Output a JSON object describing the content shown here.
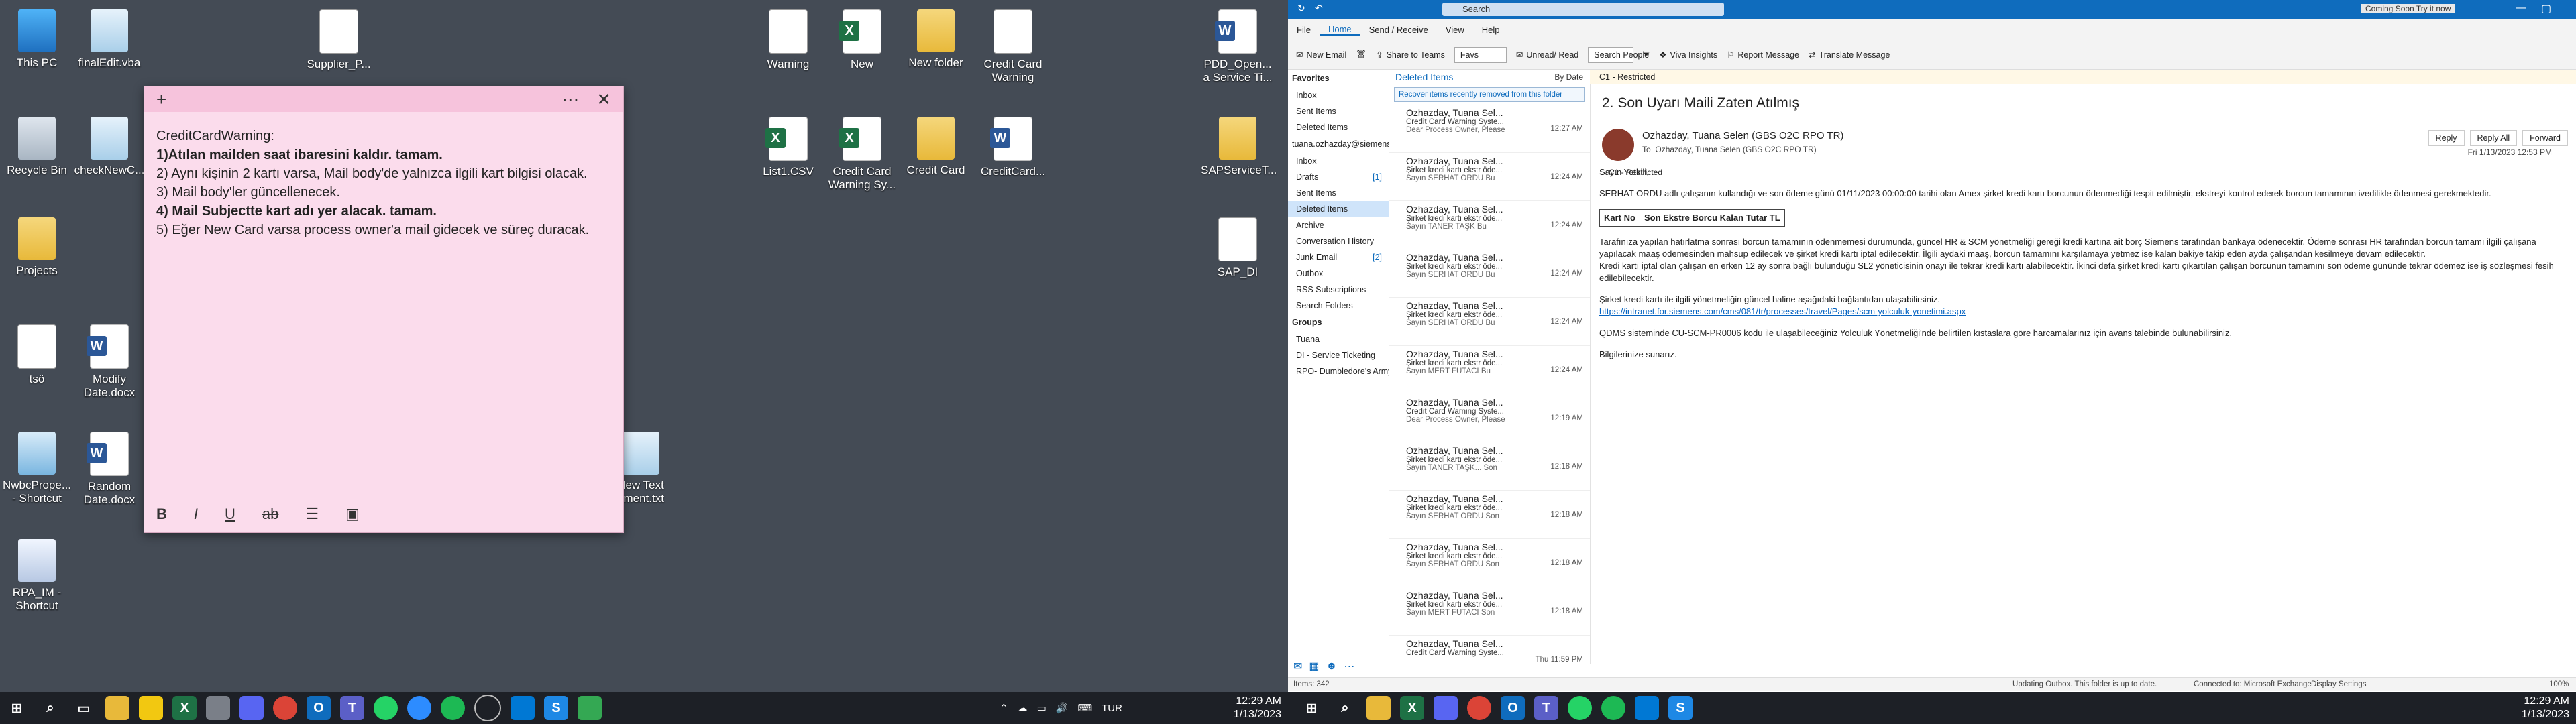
{
  "desktop": {
    "icons": [
      {
        "label": "This PC",
        "type": "pc"
      },
      {
        "label": "finalEdit.vba",
        "type": "file"
      },
      {
        "label": "Supplier_P...",
        "type": "doc"
      },
      {
        "label": "Warning",
        "type": "doc"
      },
      {
        "label": "New",
        "type": "excel"
      },
      {
        "label": "New folder",
        "type": "folder"
      },
      {
        "label": "Credit Card Warning",
        "type": "doc"
      },
      {
        "label": "PDD_Open... a Service Ti...",
        "type": "word"
      },
      {
        "label": "Recycle Bin",
        "type": "bin"
      },
      {
        "label": "checkNewC...",
        "type": "file"
      },
      {
        "label": "List1.CSV",
        "type": "excel"
      },
      {
        "label": "Credit Card Warning Sy...",
        "type": "excel"
      },
      {
        "label": "Credit Card",
        "type": "folder"
      },
      {
        "label": "CreditCard...",
        "type": "word"
      },
      {
        "label": "SAPServiceT...",
        "type": "folder"
      },
      {
        "label": "Projects",
        "type": "folder"
      },
      {
        "label": "SAP_DI",
        "type": "doc"
      },
      {
        "label": "tsö",
        "type": "doc"
      },
      {
        "label": "Modify Date.docx",
        "type": "word"
      },
      {
        "label": "NwbcPrope... - Shortcut",
        "type": "img"
      },
      {
        "label": "Random Date.docx",
        "type": "word"
      },
      {
        "label": "New Text ument.txt",
        "type": "file"
      },
      {
        "label": "RPA_IM - Shortcut",
        "type": "shortcut"
      }
    ]
  },
  "sticky": {
    "lines": [
      {
        "text": "CreditCardWarning:",
        "bold": false
      },
      {
        "text": "1)Atılan mailden saat ibaresini kaldır. tamam.",
        "bold": true
      },
      {
        "text": "2) Aynı kişinin 2 kartı varsa, Mail body'de yalnızca ilgili kart bilgisi olacak.",
        "bold": false
      },
      {
        "text": "3) Mail body'ler güncellenecek.",
        "bold": false
      },
      {
        "text": "4) Mail Subjectte kart adı yer alacak. tamam.",
        "bold": true
      },
      {
        "text": "5) Eğer New Card varsa process owner'a mail gidecek ve süreç duracak.",
        "bold": false
      }
    ],
    "toolbar": {
      "bold": "B",
      "italic": "I",
      "underline": "U",
      "strike": "ab",
      "list": "☰",
      "image": "▣"
    }
  },
  "taskbar1": {
    "lang": "TUR",
    "time": "12:29 AM",
    "date": "1/13/2023"
  },
  "outlook": {
    "title_search": "Search",
    "title_right": "Coming Soon  Try it now",
    "menu": [
      "File",
      "Home",
      "Send / Receive",
      "View",
      "Help"
    ],
    "ribbon": {
      "new_email": "New Email",
      "share_teams": "Share to Teams",
      "favs": "Favs",
      "unread_read": "Unread/ Read",
      "search_people": "Search People",
      "viva": "Viva Insights",
      "report": "Report Message",
      "translate": "Translate Message"
    },
    "folders": {
      "favorites_header": "Favorites",
      "favorites": [
        {
          "name": "Inbox",
          "count": ""
        },
        {
          "name": "Sent Items",
          "count": ""
        },
        {
          "name": "Deleted Items",
          "count": ""
        }
      ],
      "account": "tuana.ozhazday@siemens.c...",
      "items": [
        {
          "name": "Inbox",
          "count": ""
        },
        {
          "name": "Drafts",
          "count": "[1]"
        },
        {
          "name": "Sent Items",
          "count": ""
        },
        {
          "name": "Deleted Items",
          "count": ""
        },
        {
          "name": "Archive",
          "count": ""
        },
        {
          "name": "Conversation History",
          "count": ""
        },
        {
          "name": "Junk Email",
          "count": "[2]"
        },
        {
          "name": "Outbox",
          "count": ""
        },
        {
          "name": "RSS Subscriptions",
          "count": ""
        },
        {
          "name": "Search Folders",
          "count": ""
        }
      ],
      "groups_header": "Groups",
      "groups": [
        "Tuana",
        "DI - Service Ticketing",
        "RPO- Dumbledore's Army ( De..."
      ]
    },
    "list": {
      "folder_title": "Deleted Items",
      "sort": "By Date",
      "info": "Recover items recently removed from this folder",
      "messages": [
        {
          "from": "Ozhazday, Tuana Sel...",
          "subj": "Credit Card Warning Syste...",
          "prev": "Dear Process Owner,   Please",
          "time": "12:27 AM"
        },
        {
          "from": "Ozhazday, Tuana Sel...",
          "subj": "Şirket kredi kartı ekstr öde...",
          "prev": "Sayın SERHAT ORDU   Bu",
          "time": "12:24 AM"
        },
        {
          "from": "Ozhazday, Tuana Sel...",
          "subj": "Şirket kredi kartı ekstr öde...",
          "prev": "Sayın TANER TAŞK   Bu",
          "time": "12:24 AM"
        },
        {
          "from": "Ozhazday, Tuana Sel...",
          "subj": "Şirket kredi kartı ekstr öde...",
          "prev": "Sayın SERHAT ORDU   Bu",
          "time": "12:24 AM"
        },
        {
          "from": "Ozhazday, Tuana Sel...",
          "subj": "Şirket kredi kartı ekstr öde...",
          "prev": "Sayın SERHAT ORDU   Bu",
          "time": "12:24 AM"
        },
        {
          "from": "Ozhazday, Tuana Sel...",
          "subj": "Şirket kredi kartı ekstr öde...",
          "prev": "Sayın MERT FUTACI   Bu",
          "time": "12:24 AM"
        },
        {
          "from": "Ozhazday, Tuana Sel...",
          "subj": "Credit Card Warning Syste...",
          "prev": "Dear Process Owner,   Please",
          "time": "12:19 AM"
        },
        {
          "from": "Ozhazday, Tuana Sel...",
          "subj": "Şirket kredi kartı ekstr öde...",
          "prev": "Sayın TANER TAŞK...   Son",
          "time": "12:18 AM"
        },
        {
          "from": "Ozhazday, Tuana Sel...",
          "subj": "Şirket kredi kartı ekstr öde...",
          "prev": "Sayın SERHAT ORDU   Son",
          "time": "12:18 AM"
        },
        {
          "from": "Ozhazday, Tuana Sel...",
          "subj": "Şirket kredi kartı ekstr öde...",
          "prev": "Sayın SERHAT ORDU   Son",
          "time": "12:18 AM"
        },
        {
          "from": "Ozhazday, Tuana Sel...",
          "subj": "Şirket kredi kartı ekstr öde...",
          "prev": "Sayın MERT FUTACI   Son",
          "time": "12:18 AM"
        },
        {
          "from": "Ozhazday, Tuana Sel...",
          "subj": "Credit Card Warning Syste...",
          "prev": "",
          "time": "Thu 11:59 PM"
        }
      ]
    },
    "reading": {
      "classification": "C1 - Restricted",
      "subject": "2. Son Uyarı Maili Zaten Atılmış",
      "sender": "Ozhazday, Tuana Selen (GBS O2C RPO TR)",
      "to_prefix": "To",
      "to": "Ozhazday, Tuana Selen (GBS O2C RPO TR)",
      "msg_class": "C1 - Restricted",
      "actions": [
        "Reply",
        "Reply All",
        "Forward"
      ],
      "date": "Fri 1/13/2023 12:53 PM",
      "greeting": "Sayın Yetkili,",
      "para1": "SERHAT ORDU adlı çalışanın kullandığı ve son ödeme günü 01/11/2023 00:00:00 tarihi olan Amex şirket kredi kartı borcunun ödenmediği tespit edilmiştir, ekstreyi kontrol ederek borcun tamamının ivedilikle ödenmesi gerekmektedir.",
      "table_headers": [
        "Kart No",
        "Son Ekstre Borcu Kalan Tutar TL"
      ],
      "para2": "Tarafınıza yapılan hatırlatma sonrası borcun tamamının ödenmemesi durumunda, güncel HR & SCM yönetmeliği gereği kredi kartına ait borç Siemens tarafından bankaya ödenecektir. Ödeme sonrası HR tarafından borcun tamamı ilgili çalışana yapılacak maaş ödemesinden mahsup edilecek ve şirket kredi kartı iptal edilecektir. İlgili aydaki maaş, borcun tamamını karşılamaya yetmez ise kalan bakiye takip eden ayda çalışandan kesilmeye devam edilecektir.",
      "para3": "Kredi kartı iptal olan çalışan en erken 12 ay sonra bağlı bulunduğu SL2 yöneticisinin onayı ile tekrar kredi kartı alabilecektir. İkinci defa şirket kredi kartı çıkartılan çalışan borcunun tamamını son ödeme gününde tekrar ödemez ise iş sözleşmesi fesih edilebilecektir.",
      "para4": "Şirket kredi kartı ile ilgili yönetmeliğin güncel haline aşağıdaki bağlantıdan ulaşabilirsiniz.",
      "link": "https://intranet.for.siemens.com/cms/081/tr/processes/travel/Pages/scm-yolculuk-yonetimi.aspx",
      "para5": "QDMS sisteminde CU-SCM-PR0006 kodu ile ulaşabileceğiniz Yolculuk Yönetmeliği'nde belirtilen kıstaslara göre harcamalarınız için avans talebinde bulunabilirsiniz.",
      "closing": "Bilgilerinize sunarız."
    },
    "status": {
      "items": "Items: 342",
      "updating": "Updating Outbox. This folder is up to date.",
      "connected": "Connected to: Microsoft Exchange",
      "display": "Display Settings",
      "zoom": "100%"
    },
    "taskbar_time": "12:29 AM",
    "taskbar_date": "1/13/2023"
  },
  "colors": {
    "desktop_bg": "#444b55",
    "sticky_bg": "#fbdcec",
    "outlook_blue": "#0f6cbd",
    "taskbar": "#1d2026"
  }
}
